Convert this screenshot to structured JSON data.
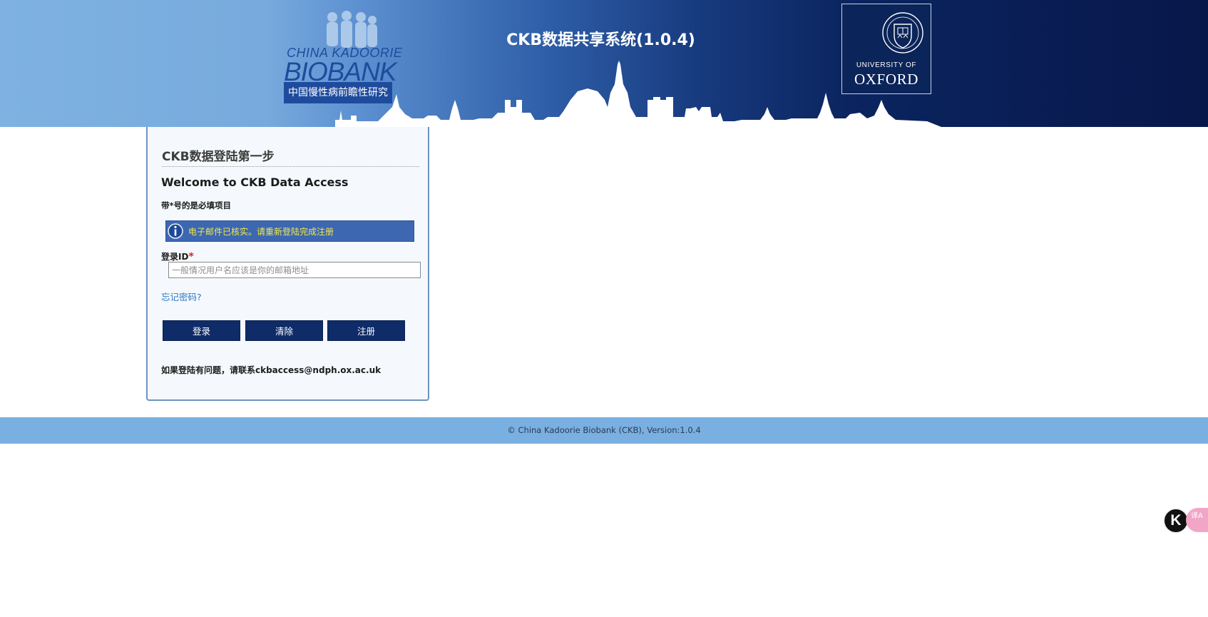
{
  "header": {
    "system_title": "CKB数据共享系统(1.0.4)",
    "cb_logo": {
      "line1": "CHINA KADOORIE",
      "line2": "BIOBANK",
      "cn_line": "中国慢性病前瞻性研究"
    },
    "oxford_logo": {
      "line1": "UNIVERSITY OF",
      "line2": "OXFORD"
    }
  },
  "login": {
    "step_title": "CKB数据登陆第一步",
    "welcome": "Welcome to CKB Data Access",
    "required_note": "带*号的是必填项目",
    "info_message": "电子邮件已核实。请重新登陆完成注册",
    "login_id_label": "登录ID",
    "required_mark": "*",
    "login_id_value": "",
    "login_id_placeholder": "一般情况用户名应该是你的邮箱地址",
    "forgot_password": "忘记密码?",
    "buttons": {
      "login": "登录",
      "clear": "清除",
      "register": "注册"
    },
    "contact_note": "如果登陆有问题，请联系ckbaccess@ndph.ox.ac.uk"
  },
  "footer": {
    "copyright": "© China Kadoorie Biobank (CKB), Version:1.0.4"
  },
  "extensions": {
    "k_label": "K",
    "translate_label": "译A"
  },
  "colors": {
    "banner_light": "#7fb2e3",
    "banner_dark": "#08174a",
    "button_navy": "#0f2c69",
    "info_blue": "#3e67b1",
    "info_text": "#f2e84a",
    "footer_blue": "#7aafe1",
    "link_blue": "#2b78c2",
    "required_red": "#d32323"
  },
  "icons": [
    "info-icon",
    "oxford-crest-icon",
    "people-silhouette-icon",
    "skyline-graphic"
  ]
}
